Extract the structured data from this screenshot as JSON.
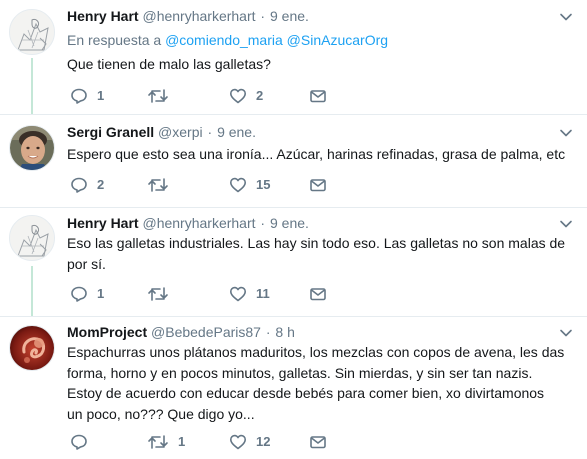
{
  "tweets": [
    {
      "name": "Henry Hart",
      "handle": "@henryharkerhart",
      "dot": "·",
      "time": "9 ene.",
      "reply_prefix": "En respuesta a",
      "reply_mentions": [
        "@comiendo_maria",
        "@SinAzucarOrg"
      ],
      "lines": [
        "Que tienen de malo las galletas?"
      ],
      "replies": "1",
      "retweets": "",
      "likes": "2",
      "avatar": "sketch-avatar"
    },
    {
      "name": "Sergi Granell",
      "handle": "@xerpi",
      "dot": "·",
      "time": "9 ene.",
      "lines": [
        "Espero que esto sea una ironía... Azúcar, harinas refinadas, grasa de palma, etc"
      ],
      "replies": "2",
      "retweets": "",
      "likes": "15",
      "avatar": "child-photo-avatar"
    },
    {
      "name": "Henry Hart",
      "handle": "@henryharkerhart",
      "dot": "·",
      "time": "9 ene.",
      "lines": [
        "Eso las galletas industriales. Las hay sin todo eso. Las galletas no son malas de",
        "por sí."
      ],
      "replies": "1",
      "retweets": "",
      "likes": "11",
      "avatar": "sketch-avatar"
    },
    {
      "name": "MomProject",
      "handle": "@BebedeParis87",
      "dot": "·",
      "time": "8 h",
      "lines": [
        "Espachurras unos plátanos maduritos, los mezclas con copos de avena, les das",
        "forma, horno y en pocos minutos, galletas. Sin mierdas, y sin ser tan nazis.",
        "Estoy de acuerdo con educar desde bebés para comer bien, xo divirtamonos",
        "un poco, no??? Que digo yo..."
      ],
      "replies": "",
      "retweets": "1",
      "likes": "12",
      "avatar": "embryo-avatar"
    }
  ],
  "colors": {
    "thread_line": "#c4e7d7",
    "mention": "#1da1f2",
    "muted": "#657786"
  }
}
